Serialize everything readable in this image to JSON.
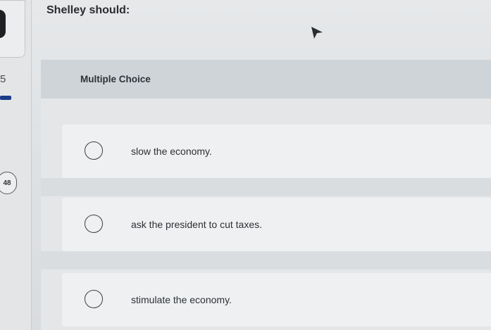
{
  "sidebar": {
    "question_number": "5",
    "badge_count": "48"
  },
  "question": {
    "prompt": "Shelley should:"
  },
  "multiple_choice": {
    "header_label": "Multiple Choice",
    "options": [
      {
        "label": "slow the economy.",
        "selected": false
      },
      {
        "label": "ask the president to cut taxes.",
        "selected": false
      },
      {
        "label": "stimulate the economy.",
        "selected": false
      }
    ]
  },
  "colors": {
    "nav_accent": "#1b3a8a",
    "header_band": "#cfd4d9",
    "option_background": "#eef0f1"
  }
}
